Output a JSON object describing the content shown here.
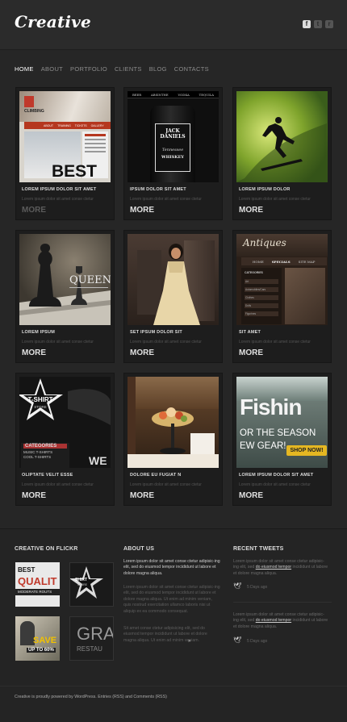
{
  "brand": {
    "logo_text": "Creative",
    "accent": "#e8b73c"
  },
  "social": [
    {
      "icon": "facebook-icon",
      "glyph": "f"
    },
    {
      "icon": "twitter-icon",
      "glyph": "t"
    },
    {
      "icon": "rss-icon",
      "glyph": "r"
    }
  ],
  "nav": [
    "HOME",
    "ABOUT",
    "PORTFOLIO",
    "CLIENTS",
    "BLOG",
    "CONTACTS"
  ],
  "cards": [
    {
      "title": "LOREM IPSUM DOLOR SIT AMET",
      "desc": "Lorem ipsum dolor sit amet conse ctetur",
      "more": "MORE",
      "more_dim": true,
      "thumb": {
        "brand": "CLIMBING",
        "menu": [
          "ABOUT",
          "TRAINING",
          "TICKETS",
          "GALLERY"
        ],
        "big": "BEST"
      }
    },
    {
      "title": "IPSUM DOLOR SIT AMET",
      "desc": "Lorem ipsum dolor sit amet conse ctetur",
      "more": "MORE",
      "more_dim": false,
      "thumb": {
        "menu": [
          "BEER",
          "ABSINTHE",
          "VODKA",
          "TEQUILA"
        ],
        "lines": [
          "JACK DANIELS",
          "Tennessee",
          "WHISKEY"
        ]
      }
    },
    {
      "title": "LOREM IPSUM DOLOR",
      "desc": "Lorem ipsum dolor sit amet conse ctetur",
      "more": "MORE",
      "more_dim": false,
      "thumb": {}
    },
    {
      "title": "LOREM IPSUM",
      "desc": "Lorem ipsum dolor sit amet conse ctetur",
      "more": "MORE",
      "more_dim": false,
      "thumb": {
        "word": "QUEEN"
      }
    },
    {
      "title": "SET IPSUM DOLOR SIT",
      "desc": "Lorem ipsum dolor sit amet conse ctetur",
      "more": "MORE",
      "more_dim": false,
      "thumb": {}
    },
    {
      "title": "SIT AMET",
      "desc": "Lorem ipsum dolor sit amet conse ctetur",
      "more": "MORE",
      "more_dim": false,
      "thumb": {
        "word": "Antiques",
        "menu": [
          "HOME",
          "SPECIALS",
          "SITE MAP"
        ],
        "cat_title": "CATEGORIES",
        "cats": [
          "Art",
          "Automobiles/Cars",
          "Clothes",
          "Dolls",
          "Figurines"
        ]
      }
    },
    {
      "title": "OLIPTATE VELIT ESSE",
      "desc": "Lorem ipsum dolor sit amet conse ctetur",
      "more": "MORE",
      "more_dim": false,
      "thumb": {
        "star_top": "T-SHIRT",
        "star_bottom": "STORE",
        "cat_title": "CATEGORIES",
        "cats": [
          "MUSIC T-SHIRTS",
          "COOL T-SHIRTS"
        ],
        "side": "WE"
      }
    },
    {
      "title": "DOLORE EU FUGIAT N",
      "desc": "Lorem ipsum dolor sit amet conse ctetur",
      "more": "MORE",
      "more_dim": false,
      "thumb": {}
    },
    {
      "title": "LOREM IPSUM DOLOR SIT AMET",
      "desc": "Lorem ipsum dolor sit amet conse ctetur",
      "more": "MORE",
      "more_dim": false,
      "thumb": {
        "big": "Fishin",
        "line1": "OR THE SEASON",
        "line2": "EW GEAR!",
        "cta": "SHOP NOW!"
      }
    }
  ],
  "footer": {
    "flickr_title": "CREATIVE ON FLICKR",
    "flickr": [
      {
        "l1": "BEST",
        "l2": "QUALIT",
        "l3": "MODERATE ROUTS"
      },
      {
        "l1": "SHIRT",
        "l2": "STORE"
      },
      {
        "l1": "SAVE",
        "l2": "UP TO 60%"
      },
      {
        "l1": "GRA",
        "l2": "RESTAU"
      }
    ],
    "about_title": "ABOUT US",
    "about_p1": "Lorem ipsum dolor sit amet conse ctetur adipisic-ing elit, sed do eiusmod tempor incididunt ut labore et dolore magna aliqua.",
    "about_p2": "Lorem ipsum dolor sit amet conse ctetur adipisic-ing elit, sed do eiusmod tempor incididunt ut labore et dolore magna aliqua. Ut enim ad minim veniam, quis nostrud exercitation ullamco laboris nisi ut aliquip ex ea commodo consequat.",
    "about_p3": "Sit amet conse ctetur adipisicing elit, sed do eiusmod tempor incididunt ut labore et dolore magna aliqua. Ut enim ad minim veniam.",
    "about_more": "»",
    "tweets_title": "RECENT TWEETS",
    "tweets": [
      {
        "pre": "Lorem ipsum dolor sit amet conse ctetur adipisic-ing elit, sed ",
        "link": "do eiusmod tempor",
        "post": " incididunt ut labore et dolore magna aliqua.",
        "when": "5 Days ago"
      },
      {
        "pre": "Lorem ipsum dolor sit amet conse ctetur adipisic-ing elit, sed ",
        "link": "do eiusmod tempor",
        "post": " incididunt ut labore et dolore magna aliqua.",
        "when": "5 Days ago"
      }
    ],
    "copyright": "Creative is proudly powered by WordPress. Entries (RSS) and Comments (RSS)"
  }
}
